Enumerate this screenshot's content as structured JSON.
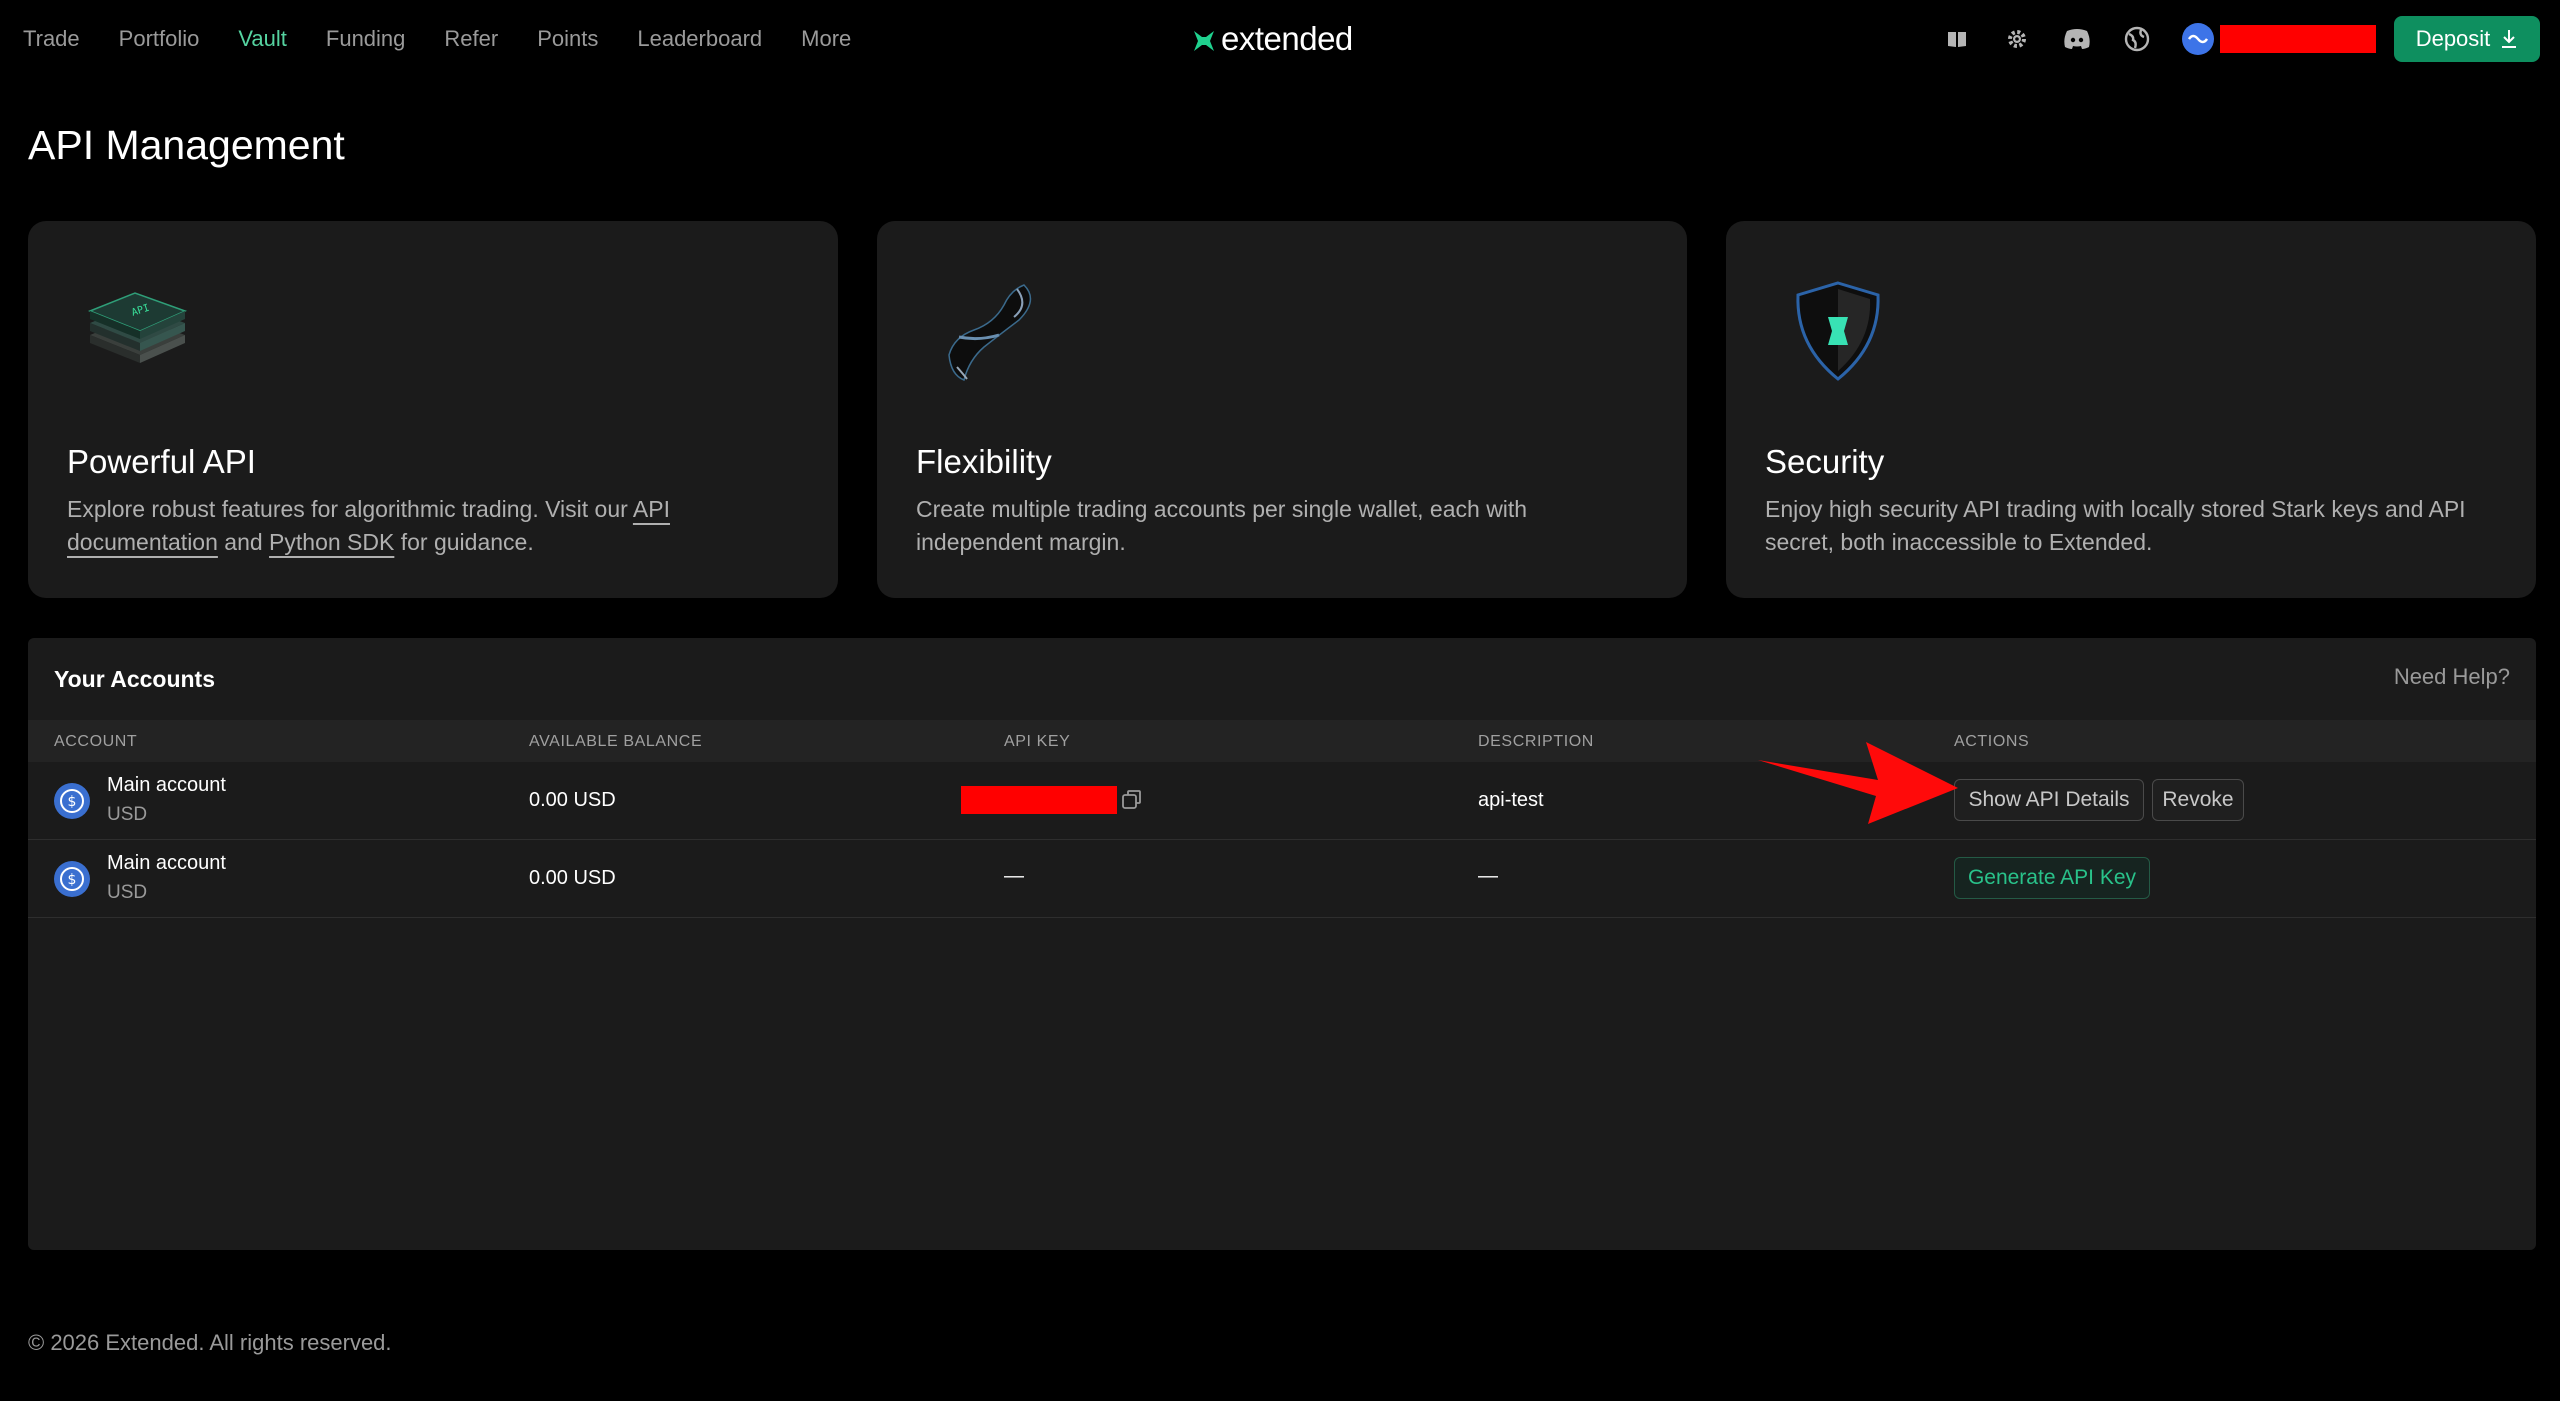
{
  "nav": {
    "items": [
      {
        "label": "Trade",
        "active": false
      },
      {
        "label": "Portfolio",
        "active": false
      },
      {
        "label": "Vault",
        "active": true
      },
      {
        "label": "Funding",
        "active": false
      },
      {
        "label": "Refer",
        "active": false
      },
      {
        "label": "Points",
        "active": false
      },
      {
        "label": "Leaderboard",
        "active": false
      },
      {
        "label": "More",
        "active": false
      }
    ]
  },
  "brand": {
    "name": "extended",
    "accent": "#1fd18e"
  },
  "header_tools": {
    "icons": [
      "book-icon",
      "gear-icon",
      "discord-icon",
      "globe-icon",
      "wallet-avatar-icon"
    ],
    "deposit_label": "Deposit"
  },
  "page": {
    "title": "API Management"
  },
  "cards": [
    {
      "title": "Powerful API",
      "desc_prefix": "Explore robust features for algorithmic trading. Visit our ",
      "link1": "API documentation",
      "desc_mid": " and ",
      "link2": "Python SDK",
      "desc_suffix": " for guidance."
    },
    {
      "title": "Flexibility",
      "desc": "Create multiple trading accounts per single wallet, each with independent margin."
    },
    {
      "title": "Security",
      "desc": "Enjoy high security API trading with locally stored Stark keys and API secret, both inaccessible to Extended."
    }
  ],
  "accounts": {
    "title": "Your Accounts",
    "help": "Need Help?",
    "columns": [
      "ACCOUNT",
      "AVAILABLE BALANCE",
      "API KEY",
      "DESCRIPTION",
      "ACTIONS"
    ],
    "rows": [
      {
        "name": "Main account",
        "currency": "USD",
        "balance": "0.00 USD",
        "api_key": "",
        "description": "api-test",
        "actions": [
          "Show API Details",
          "Revoke"
        ]
      },
      {
        "name": "Main account",
        "currency": "USD",
        "balance": "0.00 USD",
        "api_key": "—",
        "description": "—",
        "actions": [
          "Generate API Key"
        ]
      }
    ]
  },
  "footer": {
    "text": "© 2026 Extended. All rights reserved."
  },
  "colors": {
    "accent_green": "#0e8f5f",
    "link_green": "#55d3a0",
    "redaction": "#ff0000",
    "annotation_arrow": "#ff0a0a"
  }
}
